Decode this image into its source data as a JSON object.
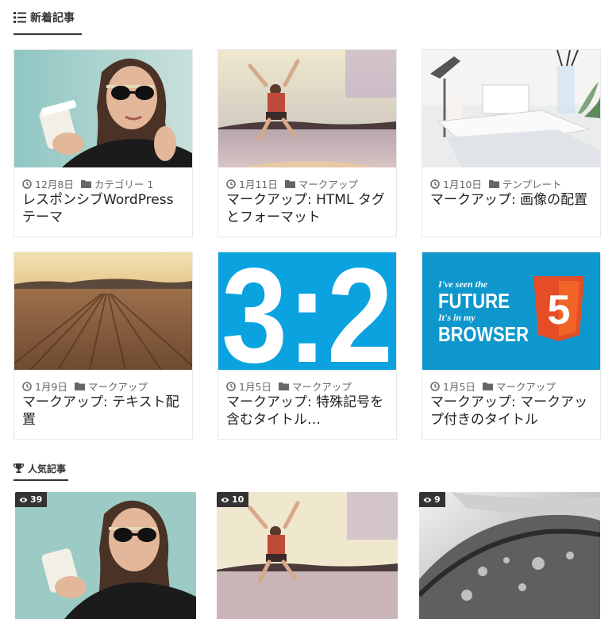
{
  "recent": {
    "heading": "新着記事",
    "heading_icon": "list-icon",
    "posts": [
      {
        "date": "12月8日",
        "category": "カテゴリー 1",
        "title": "レスポンシブWordPress テーマ",
        "image": "woman-sunglasses-coffee"
      },
      {
        "date": "1月11日",
        "category": "マークアップ",
        "title": "マークアップ: HTML タグとフォーマット",
        "image": "person-jumping-lake"
      },
      {
        "date": "1月10日",
        "category": "テンプレート",
        "title": "マークアップ: 画像の配置",
        "image": "desk-with-books"
      },
      {
        "date": "1月9日",
        "category": "マークアップ",
        "title": "マークアップ: テキスト配置",
        "image": "plowed-field"
      },
      {
        "date": "1月5日",
        "category": "マークアップ",
        "title": "マークアップ: 特殊記号を含むタイトル…",
        "image": "ratio-3-2",
        "image_text": "3:2"
      },
      {
        "date": "1月5日",
        "category": "マークアップ",
        "title": "マークアップ: マークアップ付きのタイトル",
        "image": "html5-future-browser",
        "image_lines": [
          "I've seen the",
          "FUTURE",
          "It's in my",
          "BROWSER"
        ],
        "image_badge": "5"
      }
    ]
  },
  "popular": {
    "heading": "人気記事",
    "heading_icon": "trophy-icon",
    "posts": [
      {
        "views": "39",
        "image": "woman-sunglasses-coffee"
      },
      {
        "views": "10",
        "image": "person-jumping-lake"
      },
      {
        "views": "9",
        "image": "boat-hull-bw"
      }
    ]
  },
  "icons": {
    "date": "clock-icon",
    "category": "folder-icon",
    "views": "eye-icon"
  },
  "colors": {
    "accent_blue": "#0aa3e0",
    "html5_orange": "#e44d26",
    "badge_bg": "#333333"
  }
}
